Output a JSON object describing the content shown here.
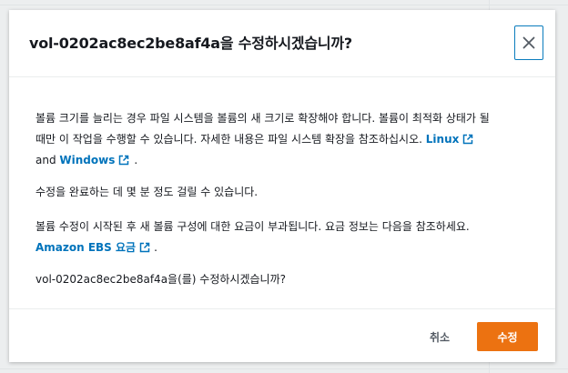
{
  "modal": {
    "title": "vol-0202ac8ec2be8af4a을 수정하시겠습니까?",
    "close_icon": "close-icon",
    "body": {
      "p1_line1": "볼륨 크기를 늘리는 경우 파일 시스템을 볼륨의 새 크기로 확장해야 합니다. 볼륨이 최적화 상태가 될",
      "p1_line2_text": "때만 이 작업을 수행할 수 있습니다. 자세한 내용은 파일 시스템 확장을 참조하십시오. ",
      "link_linux": "Linux",
      "p1_line3_and": "and ",
      "link_windows": "Windows",
      "p1_line3_end": ".",
      "p2": "수정을 완료하는 데 몇 분 정도 걸릴 수 있습니다.",
      "p3_line1": "볼륨 수정이 시작된 후 새 볼륨 구성에 대한 요금이 부과됩니다. 요금 정보는 다음을 참조하세요.",
      "link_pricing": "Amazon EBS 요금",
      "p3_line2_end": ".",
      "p4": "vol-0202ac8ec2be8af4a을(를) 수정하시겠습니까?"
    },
    "footer": {
      "cancel_label": "취소",
      "confirm_label": "수정"
    }
  },
  "colors": {
    "accent_link": "#0073bb",
    "primary_button": "#ec7211",
    "close_border": "#0a7cbd"
  },
  "icons": {
    "external_link": "external-link-icon"
  }
}
